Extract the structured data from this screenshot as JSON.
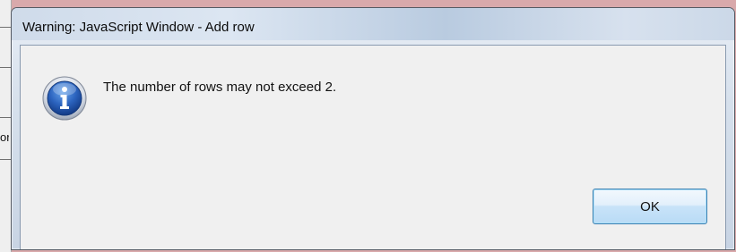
{
  "background": {
    "fragment_text": "or"
  },
  "dialog": {
    "title": "Warning: JavaScript Window - Add row",
    "icon": "info-icon",
    "message": "The number of rows may not exceed 2.",
    "ok_label": "OK"
  },
  "colors": {
    "desktop": "#d9a9ab",
    "client": "#f0f0f0",
    "icon_blue": "#1f56a8",
    "button_border": "#3c7fb1"
  }
}
